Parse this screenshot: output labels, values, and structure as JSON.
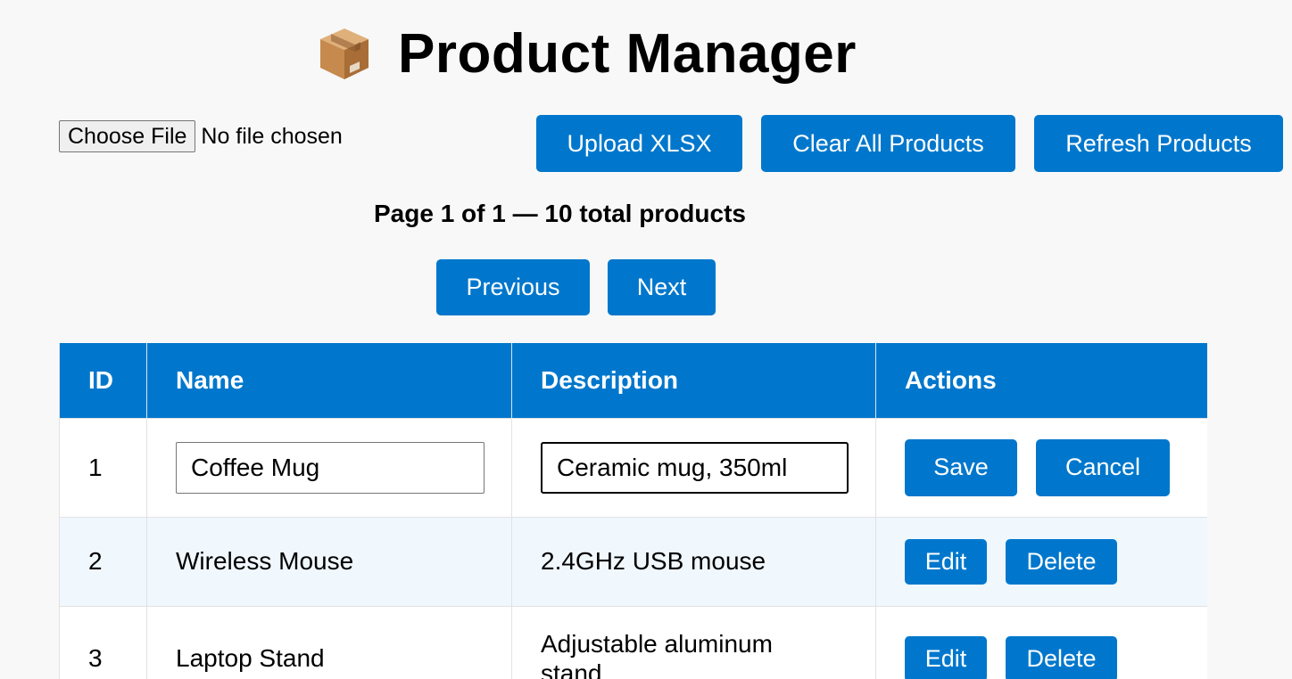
{
  "header": {
    "icon": "package-icon",
    "title": "Product Manager"
  },
  "upload": {
    "choose_file_label": "Choose File",
    "file_status": "No file chosen"
  },
  "toolbar": {
    "upload_label": "Upload XLSX",
    "clear_label": "Clear All Products",
    "refresh_label": "Refresh Products"
  },
  "pagination": {
    "info": "Page 1 of 1 — 10 total products",
    "previous_label": "Previous",
    "next_label": "Next"
  },
  "table": {
    "columns": [
      "ID",
      "Name",
      "Description",
      "Actions"
    ],
    "rows": [
      {
        "id": "1",
        "name": "Coffee Mug",
        "description": "Ceramic mug, 350ml",
        "editing": true,
        "action_primary": "Save",
        "action_secondary": "Cancel"
      },
      {
        "id": "2",
        "name": "Wireless Mouse",
        "description": "2.4GHz USB mouse",
        "editing": false,
        "action_primary": "Edit",
        "action_secondary": "Delete"
      },
      {
        "id": "3",
        "name": "Laptop Stand",
        "description": "Adjustable aluminum stand",
        "editing": false,
        "action_primary": "Edit",
        "action_secondary": "Delete"
      }
    ]
  },
  "colors": {
    "accent": "#0077cc",
    "page_background": "#f8f8f8",
    "alt_row": "#f0f7fd"
  }
}
